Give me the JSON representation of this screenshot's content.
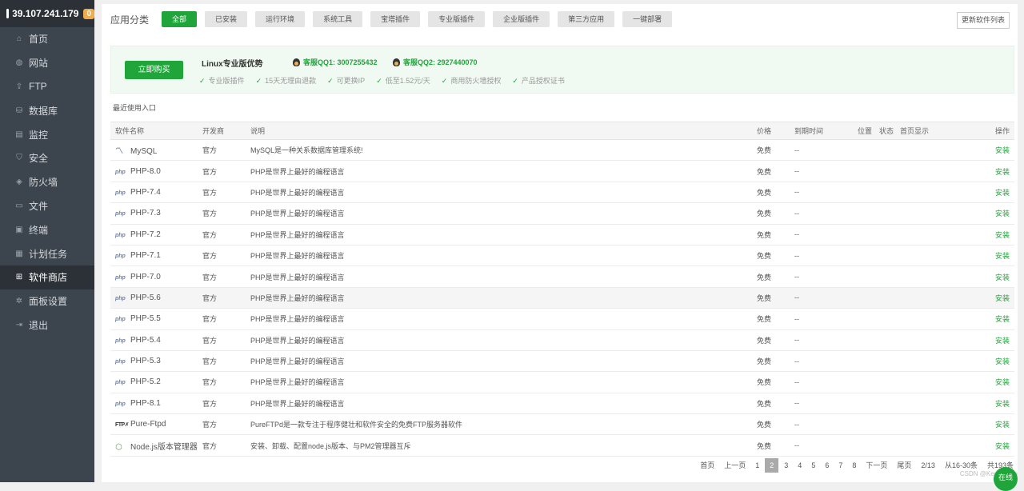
{
  "sidebar": {
    "server_ip": "39.107.241.179",
    "badge": "0",
    "items": [
      {
        "label": "首页",
        "icon": "home-icon"
      },
      {
        "label": "网站",
        "icon": "globe-icon"
      },
      {
        "label": "FTP",
        "icon": "ftp-icon"
      },
      {
        "label": "数据库",
        "icon": "database-icon"
      },
      {
        "label": "监控",
        "icon": "monitor-icon"
      },
      {
        "label": "安全",
        "icon": "shield-icon"
      },
      {
        "label": "防火墙",
        "icon": "firewall-icon"
      },
      {
        "label": "文件",
        "icon": "folder-icon"
      },
      {
        "label": "终端",
        "icon": "terminal-icon"
      },
      {
        "label": "计划任务",
        "icon": "calendar-icon"
      },
      {
        "label": "软件商店",
        "icon": "grid-icon",
        "active": true
      },
      {
        "label": "面板设置",
        "icon": "gear-icon"
      },
      {
        "label": "退出",
        "icon": "logout-icon"
      }
    ]
  },
  "categories": {
    "label": "应用分类",
    "items": [
      "全部",
      "已安装",
      "运行环境",
      "系统工具",
      "宝塔插件",
      "专业版插件",
      "企业版插件",
      "第三方应用",
      "一键部署"
    ],
    "update_button": "更新软件列表"
  },
  "promo": {
    "buy_label": "立即购买",
    "title": "Linux专业版优势",
    "qq1": "客服QQ1: 3007255432",
    "qq2": "客服QQ2: 2927440070",
    "features": [
      "专业版插件",
      "15天无理由退款",
      "可更换IP",
      "低至1.52元/天",
      "商用防火墙授权",
      "产品授权证书"
    ]
  },
  "recent_label": "最近使用入口",
  "table": {
    "headers": [
      "软件名称",
      "开发商",
      "说明",
      "价格",
      "到期时间",
      "位置",
      "状态",
      "首页显示",
      "操作"
    ],
    "rows": [
      {
        "name": "MySQL",
        "icon": "mysql",
        "vendor": "官方",
        "desc": "MySQL是一种关系数据库管理系统!",
        "price": "免费",
        "expire": "--",
        "action": "安装"
      },
      {
        "name": "PHP-8.0",
        "icon": "php",
        "vendor": "官方",
        "desc": "PHP是世界上最好的编程语言",
        "price": "免费",
        "expire": "--",
        "action": "安装"
      },
      {
        "name": "PHP-7.4",
        "icon": "php",
        "vendor": "官方",
        "desc": "PHP是世界上最好的编程语言",
        "price": "免费",
        "expire": "--",
        "action": "安装"
      },
      {
        "name": "PHP-7.3",
        "icon": "php",
        "vendor": "官方",
        "desc": "PHP是世界上最好的编程语言",
        "price": "免费",
        "expire": "--",
        "action": "安装"
      },
      {
        "name": "PHP-7.2",
        "icon": "php",
        "vendor": "官方",
        "desc": "PHP是世界上最好的编程语言",
        "price": "免费",
        "expire": "--",
        "action": "安装"
      },
      {
        "name": "PHP-7.1",
        "icon": "php",
        "vendor": "官方",
        "desc": "PHP是世界上最好的编程语言",
        "price": "免费",
        "expire": "--",
        "action": "安装"
      },
      {
        "name": "PHP-7.0",
        "icon": "php",
        "vendor": "官方",
        "desc": "PHP是世界上最好的编程语言",
        "price": "免费",
        "expire": "--",
        "action": "安装"
      },
      {
        "name": "PHP-5.6",
        "icon": "php",
        "vendor": "官方",
        "desc": "PHP是世界上最好的编程语言",
        "price": "免费",
        "expire": "--",
        "action": "安装",
        "highlight": true
      },
      {
        "name": "PHP-5.5",
        "icon": "php",
        "vendor": "官方",
        "desc": "PHP是世界上最好的编程语言",
        "price": "免费",
        "expire": "--",
        "action": "安装"
      },
      {
        "name": "PHP-5.4",
        "icon": "php",
        "vendor": "官方",
        "desc": "PHP是世界上最好的编程语言",
        "price": "免费",
        "expire": "--",
        "action": "安装"
      },
      {
        "name": "PHP-5.3",
        "icon": "php",
        "vendor": "官方",
        "desc": "PHP是世界上最好的编程语言",
        "price": "免费",
        "expire": "--",
        "action": "安装"
      },
      {
        "name": "PHP-5.2",
        "icon": "php",
        "vendor": "官方",
        "desc": "PHP是世界上最好的编程语言",
        "price": "免费",
        "expire": "--",
        "action": "安装"
      },
      {
        "name": "PHP-8.1",
        "icon": "php",
        "vendor": "官方",
        "desc": "PHP是世界上最好的编程语言",
        "price": "免费",
        "expire": "--",
        "action": "安装"
      },
      {
        "name": "Pure-Ftpd",
        "icon": "ftp",
        "vendor": "官方",
        "desc": "PureFTPd是一款专注于程序健壮和软件安全的免费FTP服务器软件",
        "price": "免费",
        "expire": "--",
        "action": "安装"
      },
      {
        "name": "Node.js版本管理器",
        "icon": "node",
        "vendor": "官方",
        "desc": "安装、卸载、配置node.js版本、与PM2管理器互斥",
        "price": "免费",
        "expire": "--",
        "action": "安装"
      }
    ]
  },
  "pager": {
    "items": [
      "首页",
      "上一页",
      "1",
      "2",
      "3",
      "4",
      "5",
      "6",
      "7",
      "8",
      "下一页",
      "尾页",
      "2/13",
      "从16-30条",
      "共193条"
    ],
    "current": "2"
  },
  "watermark": "CSDN @Kevin-Ding",
  "online_label": "在线"
}
